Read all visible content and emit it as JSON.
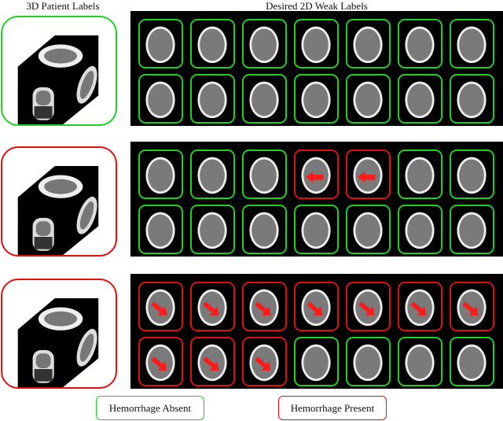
{
  "headers": {
    "left": "3D Patient Labels",
    "right": "Desired 2D Weak Labels"
  },
  "colors": {
    "absent": "#1fd11f",
    "present": "#e01010",
    "arrow": "#ff1a1a"
  },
  "rows": [
    {
      "patient_label": "absent",
      "slices": [
        "absent",
        "absent",
        "absent",
        "absent",
        "absent",
        "absent",
        "absent",
        "absent",
        "absent",
        "absent",
        "absent",
        "absent",
        "absent",
        "absent"
      ],
      "arrows": []
    },
    {
      "patient_label": "present",
      "slices": [
        "absent",
        "absent",
        "absent",
        "present",
        "present",
        "absent",
        "absent",
        "absent",
        "absent",
        "absent",
        "absent",
        "absent",
        "absent",
        "absent"
      ],
      "arrows": [
        "none",
        "none",
        "none",
        "left",
        "left",
        "none",
        "none",
        "none",
        "none",
        "none",
        "none",
        "none",
        "none",
        "none"
      ]
    },
    {
      "patient_label": "present",
      "slices": [
        "present",
        "present",
        "present",
        "present",
        "present",
        "present",
        "present",
        "present",
        "present",
        "present",
        "absent",
        "absent",
        "absent",
        "absent"
      ],
      "arrows": [
        "down-right",
        "down-right",
        "down-right",
        "down-right",
        "down-right",
        "down-right",
        "down-right",
        "down-right",
        "down-right",
        "down-right",
        "none",
        "none",
        "none",
        "none"
      ]
    }
  ],
  "legend": {
    "absent": "Hemorrhage Absent",
    "present": "Hemorrhage Present"
  }
}
